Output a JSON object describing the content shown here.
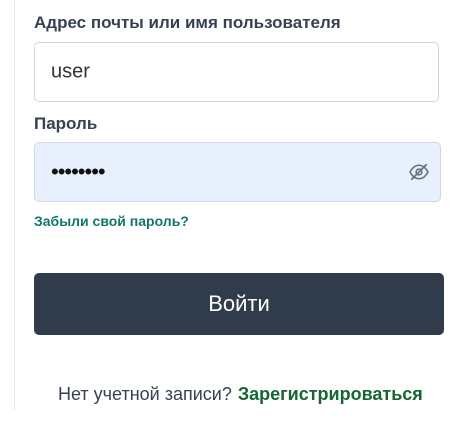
{
  "login_form": {
    "username_label": "Адрес почты или имя пользователя",
    "username_value": "user",
    "password_label": "Пароль",
    "password_value": "••••••••",
    "password_toggle_icon": "eye-slash-icon",
    "forgot_password_link": "Забыли свой пароль?",
    "submit_label": "Войти"
  },
  "signup": {
    "prompt": "Нет учетной записи?",
    "link_label": "Зарегистрироваться"
  },
  "colors": {
    "button_bg": "#303b4b",
    "autofill_bg": "#e8f0fe",
    "link_green": "#166534"
  }
}
